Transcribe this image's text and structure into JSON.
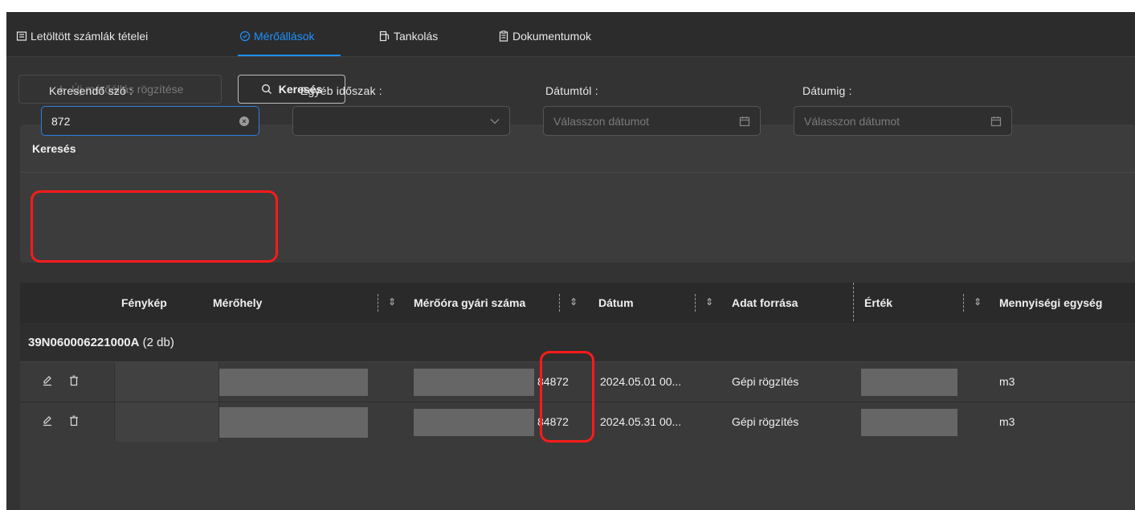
{
  "tabs": [
    {
      "label": "Letöltött számlák tételei",
      "icon": "invoice-list-icon"
    },
    {
      "label": "Mérőállások",
      "icon": "meter-check-icon",
      "active": true
    },
    {
      "label": "Tankolás",
      "icon": "fuel-icon"
    },
    {
      "label": "Dokumentumok",
      "icon": "document-icon"
    }
  ],
  "toolbar": {
    "add_label": "Új mérőállás rögzítése",
    "search_label": "Keresés"
  },
  "search_panel": {
    "title": "Keresés",
    "keyword_label": "Keresendő szó",
    "keyword_value": "872",
    "period_label": "Egyéb időszak",
    "from_label": "Dátumtól",
    "from_placeholder": "Válasszon dátumot",
    "to_label": "Dátumig",
    "to_placeholder": "Válasszon dátumot"
  },
  "table": {
    "columns": [
      "Fénykép",
      "Mérőhely",
      "Mérőóra gyári száma",
      "Dátum",
      "Adat forrása",
      "Érték",
      "Mennyiségi egység"
    ],
    "group": {
      "id": "39N060006221000A",
      "count": "(2 db)"
    },
    "rows": [
      {
        "serial_suffix": "84872",
        "date": "2024.05.01 00...",
        "source": "Gépi rögzítés",
        "unit": "m3"
      },
      {
        "serial_suffix": "84872",
        "date": "2024.05.31 00...",
        "source": "Gépi rögzítés",
        "unit": "m3"
      }
    ]
  },
  "colors": {
    "accent": "#1e90ff",
    "highlight": "#ff1a1a",
    "background": "#333333"
  }
}
